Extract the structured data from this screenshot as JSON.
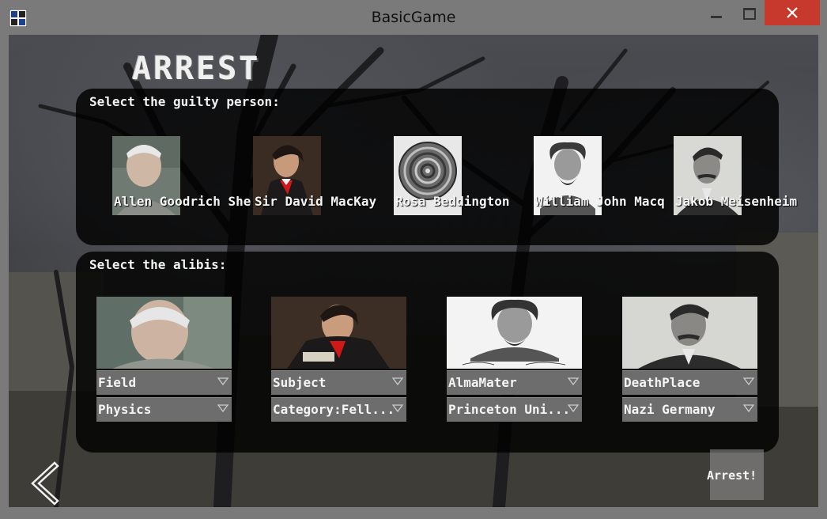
{
  "window": {
    "title": "BasicGame"
  },
  "screen": {
    "heading": "ARREST"
  },
  "suspects": {
    "label": "Select the guilty person:",
    "items": [
      {
        "name": "Allen Goodrich She",
        "portrait": "elderly-man-photo"
      },
      {
        "name": "Sir David MacKay",
        "portrait": "composer-portrait"
      },
      {
        "name": "Rosa Beddington",
        "portrait": "spiral-medal"
      },
      {
        "name": "William John Macq",
        "portrait": "bearded-man-engraving"
      },
      {
        "name": "Jakob Meisenheim",
        "portrait": "mustached-man-photo"
      }
    ],
    "selected_index": 2
  },
  "alibis": {
    "label": "Select the alibis:",
    "items": [
      {
        "portrait": "elderly-man-photo",
        "key": "Field",
        "value": "Physics"
      },
      {
        "portrait": "composer-portrait",
        "key": "Subject",
        "value": "Category:Fell..."
      },
      {
        "portrait": "bearded-man-engraving",
        "key": "AlmaMater",
        "value": "Princeton Uni..."
      },
      {
        "portrait": "mustached-man-photo",
        "key": "DeathPlace",
        "value": "Nazi Germany"
      }
    ]
  },
  "buttons": {
    "arrest": "Arrest!",
    "back_icon": "chevron-left-icon"
  },
  "colors": {
    "selected_border": "#e00000",
    "close_button": "#c7392d",
    "panel": "#000000"
  }
}
